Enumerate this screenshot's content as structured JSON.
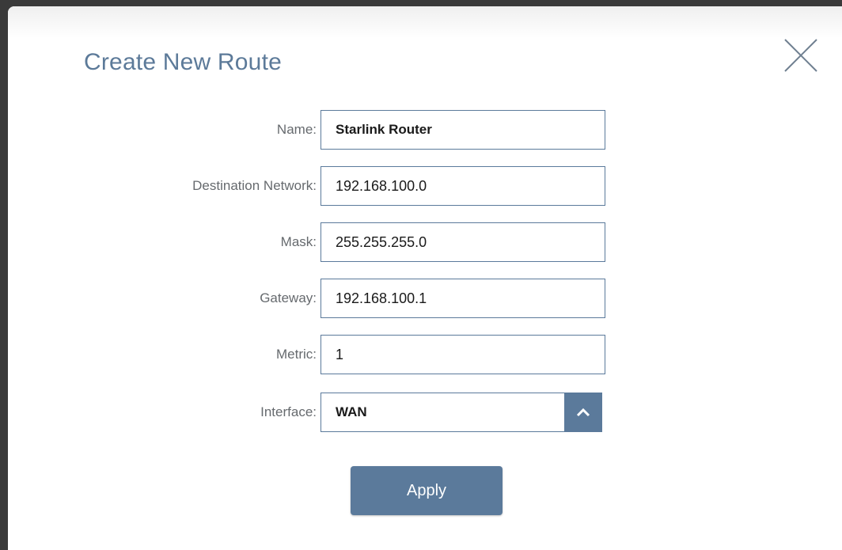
{
  "dialog": {
    "title": "Create New Route",
    "close_icon": "close-icon",
    "apply_label": "Apply"
  },
  "form": {
    "name": {
      "label": "Name:",
      "value": "Starlink Router"
    },
    "destination": {
      "label": "Destination Network:",
      "value": "192.168.100.0"
    },
    "mask": {
      "label": "Mask:",
      "value": "255.255.255.0"
    },
    "gateway": {
      "label": "Gateway:",
      "value": "192.168.100.1"
    },
    "metric": {
      "label": "Metric:",
      "value": "1"
    },
    "interface": {
      "label": "Interface:",
      "value": "WAN",
      "arrow_icon": "chevron-up-icon"
    }
  },
  "colors": {
    "accent": "#5b7a9b",
    "title": "#5c7a99",
    "label": "#666a6e"
  }
}
